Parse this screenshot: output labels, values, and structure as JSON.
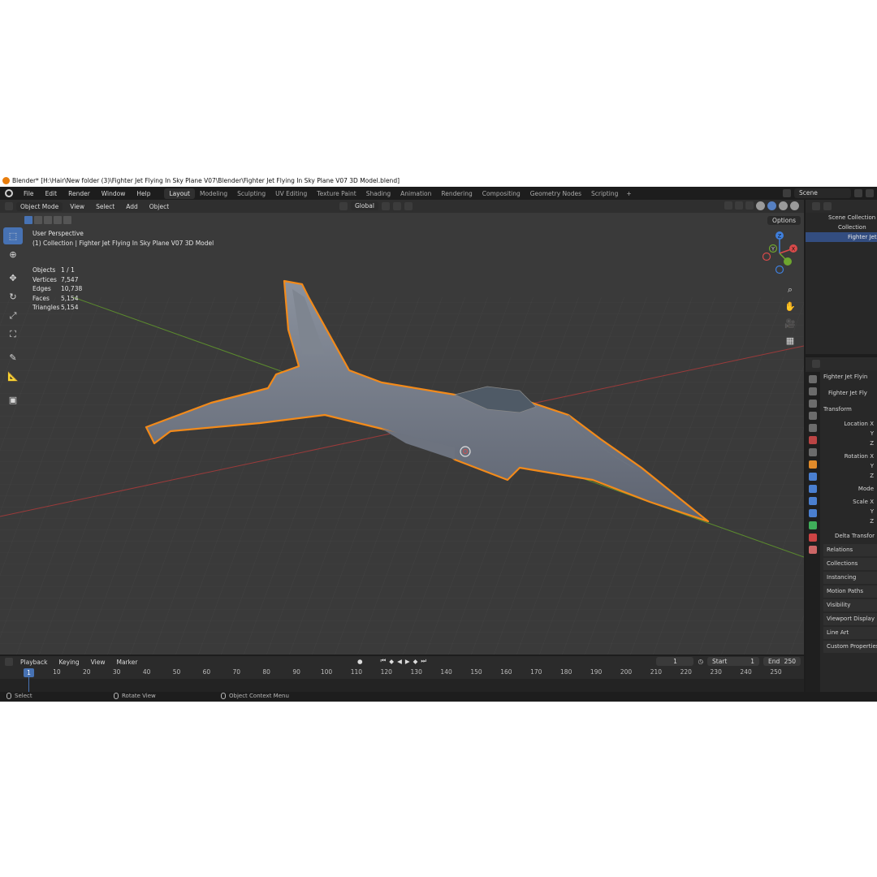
{
  "window": {
    "title": "Blender* [H:\\Hair\\New folder (3)\\Fighter Jet Flying In Sky Plane V07\\Blender\\Fighter Jet Flying In Sky Plane V07 3D Model.blend]"
  },
  "menu": [
    "File",
    "Edit",
    "Render",
    "Window",
    "Help"
  ],
  "workspaces": [
    "Layout",
    "Modeling",
    "Sculpting",
    "UV Editing",
    "Texture Paint",
    "Shading",
    "Animation",
    "Rendering",
    "Compositing",
    "Geometry Nodes",
    "Scripting"
  ],
  "scene": {
    "name": "Scene"
  },
  "viewport": {
    "mode": "Object Mode",
    "menus": [
      "View",
      "Select",
      "Add",
      "Object"
    ],
    "transform_orientation": "Global",
    "options_label": "Options",
    "perspective": "User Perspective",
    "collection_info": "(1) Collection | Fighter Jet Flying In Sky Plane V07 3D Model",
    "stats": [
      {
        "label": "Objects",
        "value": "1 / 1"
      },
      {
        "label": "Vertices",
        "value": "7,547"
      },
      {
        "label": "Edges",
        "value": "10,738"
      },
      {
        "label": "Faces",
        "value": "5,154"
      },
      {
        "label": "Triangles",
        "value": "5,154"
      }
    ],
    "gizmo": {
      "x": "X",
      "y": "Y",
      "z": "Z"
    }
  },
  "outliner": {
    "items": [
      "Scene Collection",
      "Collection",
      "Fighter Jet F"
    ]
  },
  "properties": {
    "object_name": "Fighter Jet Flyin",
    "object_field": "Fighter Jet Fly",
    "transform_label": "Transform",
    "fields": [
      "Location X",
      "Y",
      "Z",
      "Rotation X",
      "Y",
      "Z",
      "Mode",
      "Scale X",
      "Y",
      "Z"
    ],
    "delta": "Delta Transfor",
    "panels": [
      "Relations",
      "Collections",
      "Instancing",
      "Motion Paths",
      "Visibility",
      "Viewport Display",
      "Line Art",
      "Custom Properties"
    ]
  },
  "timeline": {
    "menus": [
      "Playback",
      "Keying",
      "View",
      "Marker"
    ],
    "current_frame": "1",
    "start_label": "Start",
    "start": "1",
    "end_label": "End",
    "end": "250",
    "ticks": [
      "10",
      "20",
      "30",
      "40",
      "50",
      "60",
      "70",
      "80",
      "90",
      "100",
      "110",
      "120",
      "130",
      "140",
      "150",
      "160",
      "170",
      "180",
      "190",
      "200",
      "210",
      "220",
      "230",
      "240",
      "250"
    ],
    "cursor_label": "1"
  },
  "statusbar": {
    "select": "Select",
    "rotate": "Rotate View",
    "context": "Object Context Menu"
  },
  "colors": {
    "accent": "#4772b3",
    "selection_outline": "#f28a1a",
    "background": "#3a3a3a"
  }
}
